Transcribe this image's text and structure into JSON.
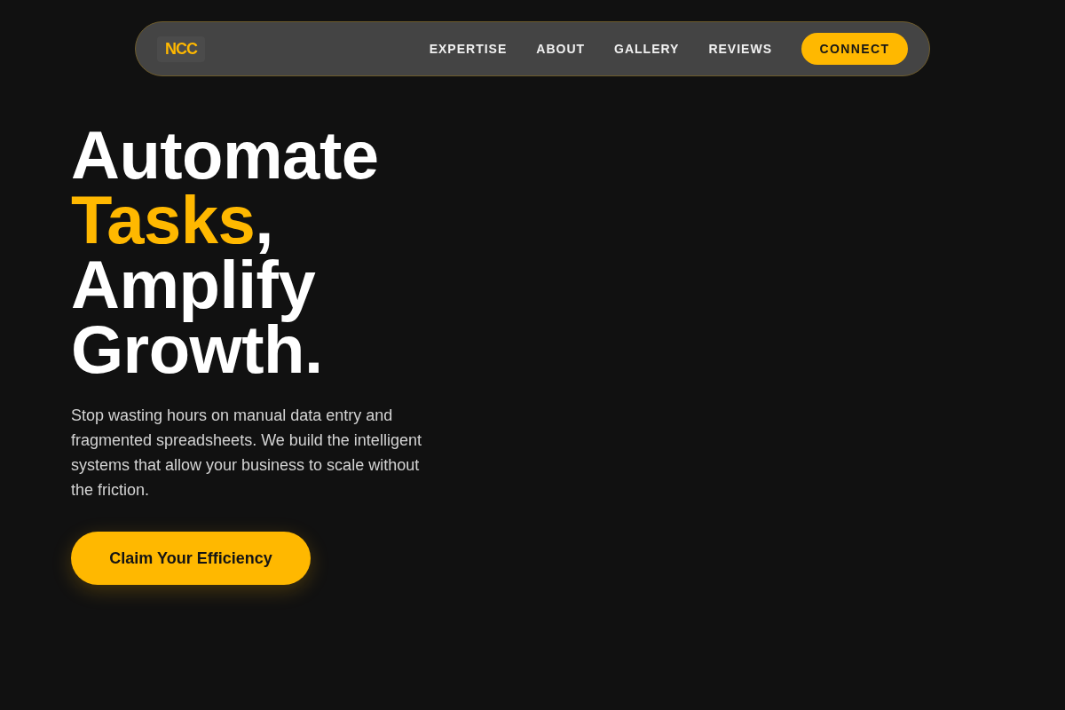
{
  "nav": {
    "logo": "NCC",
    "links": [
      "EXPERTISE",
      "ABOUT",
      "GALLERY",
      "REVIEWS"
    ],
    "cta": "CONNECT"
  },
  "hero": {
    "headline": [
      {
        "text": "Automate ",
        "accent": false
      },
      {
        "text": "Tasks",
        "accent": true
      },
      {
        "text": ", Amplify Growth.",
        "accent": false
      }
    ],
    "description": "Stop wasting hours on manual data entry and fragmented spreadsheets. We build the intelligent systems that allow your business to scale without the friction.",
    "button": "Claim Your Efficiency"
  }
}
